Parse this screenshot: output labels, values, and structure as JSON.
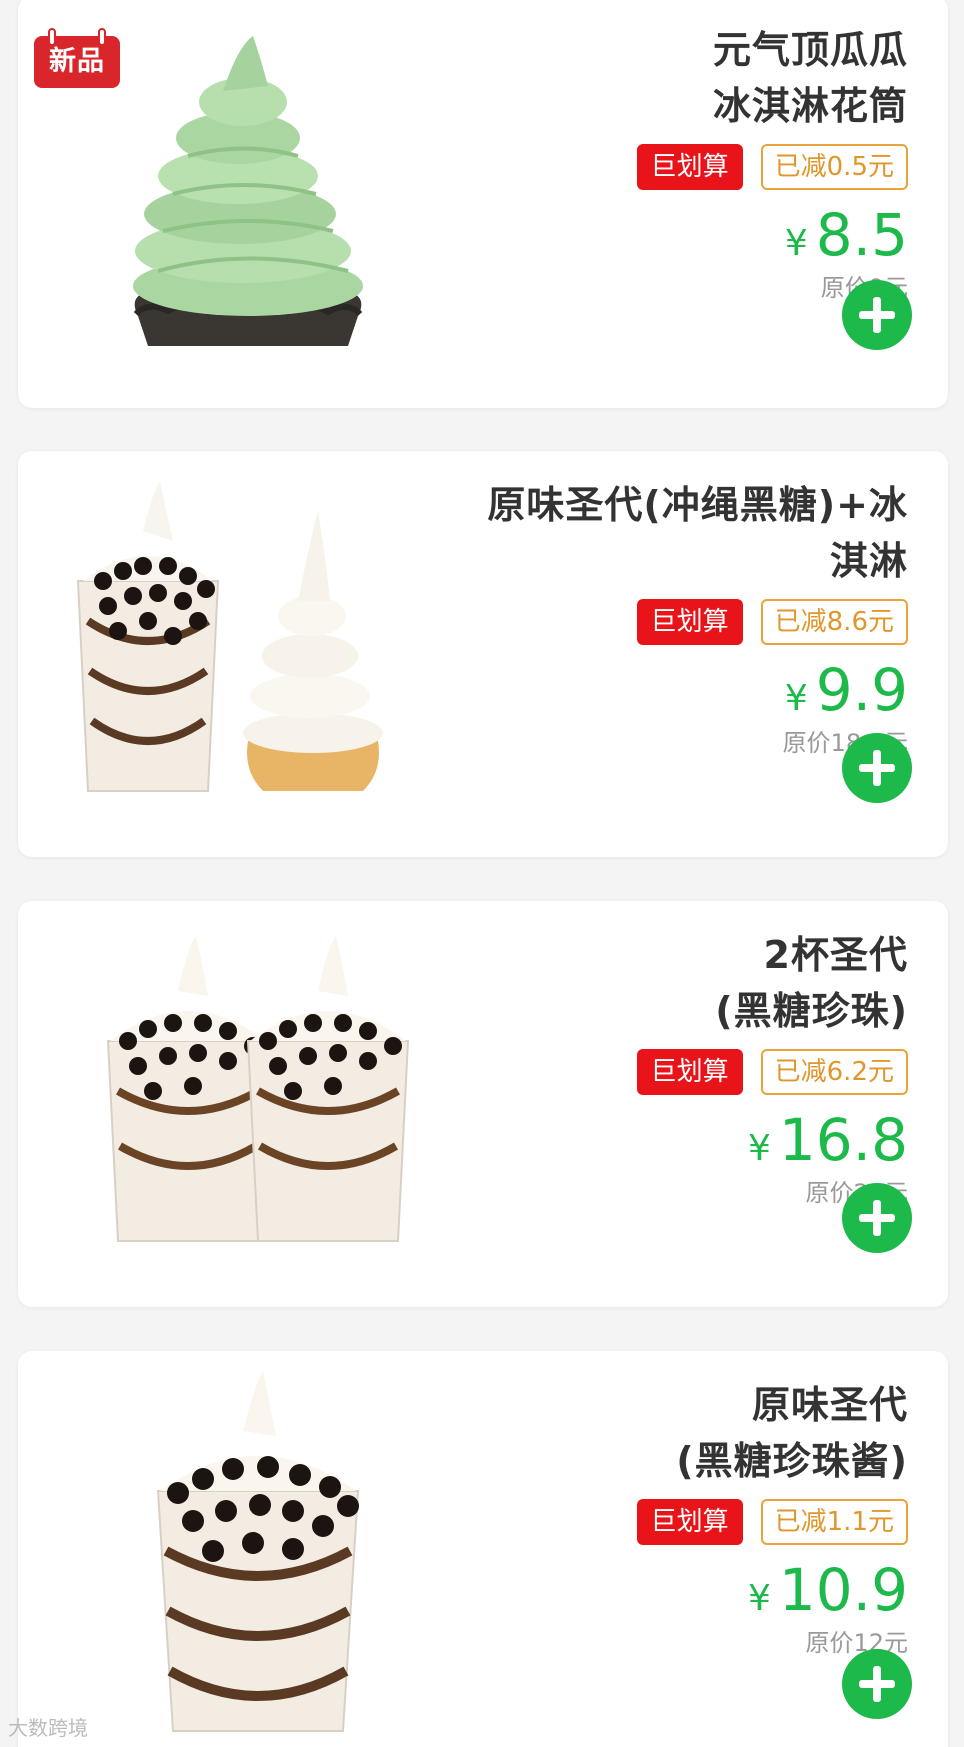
{
  "products": [
    {
      "title_line1": "元气顶瓜瓜",
      "title_line2": "冰淇淋花筒",
      "new_badge": "新品",
      "deal_tag": "巨划算",
      "save_tag": "已减0.5元",
      "currency": "¥",
      "price": "8.5",
      "original_price": "原价9元",
      "image": "green-cone-icon"
    },
    {
      "title_line1": "原味圣代(冲绳黑糖)+冰",
      "title_line2": "淇淋",
      "deal_tag": "巨划算",
      "save_tag": "已减8.6元",
      "currency": "¥",
      "price": "9.9",
      "original_price": "原价18.5元",
      "image": "sundae-and-cone-icon"
    },
    {
      "title_line1": "2杯圣代",
      "title_line2": "(黑糖珍珠)",
      "deal_tag": "巨划算",
      "save_tag": "已减6.2元",
      "currency": "¥",
      "price": "16.8",
      "original_price": "原价23元",
      "image": "two-sundaes-icon"
    },
    {
      "title_line1": "原味圣代",
      "title_line2": "(黑糖珍珠酱)",
      "deal_tag": "巨划算",
      "save_tag": "已减1.1元",
      "currency": "¥",
      "price": "10.9",
      "original_price": "原价12元",
      "image": "sundae-icon"
    }
  ],
  "watermark": "大数跨境",
  "colors": {
    "price_green": "#1db94a",
    "deal_red": "#e8141a",
    "save_orange": "#e0962a",
    "new_badge_red": "#d9262b"
  }
}
